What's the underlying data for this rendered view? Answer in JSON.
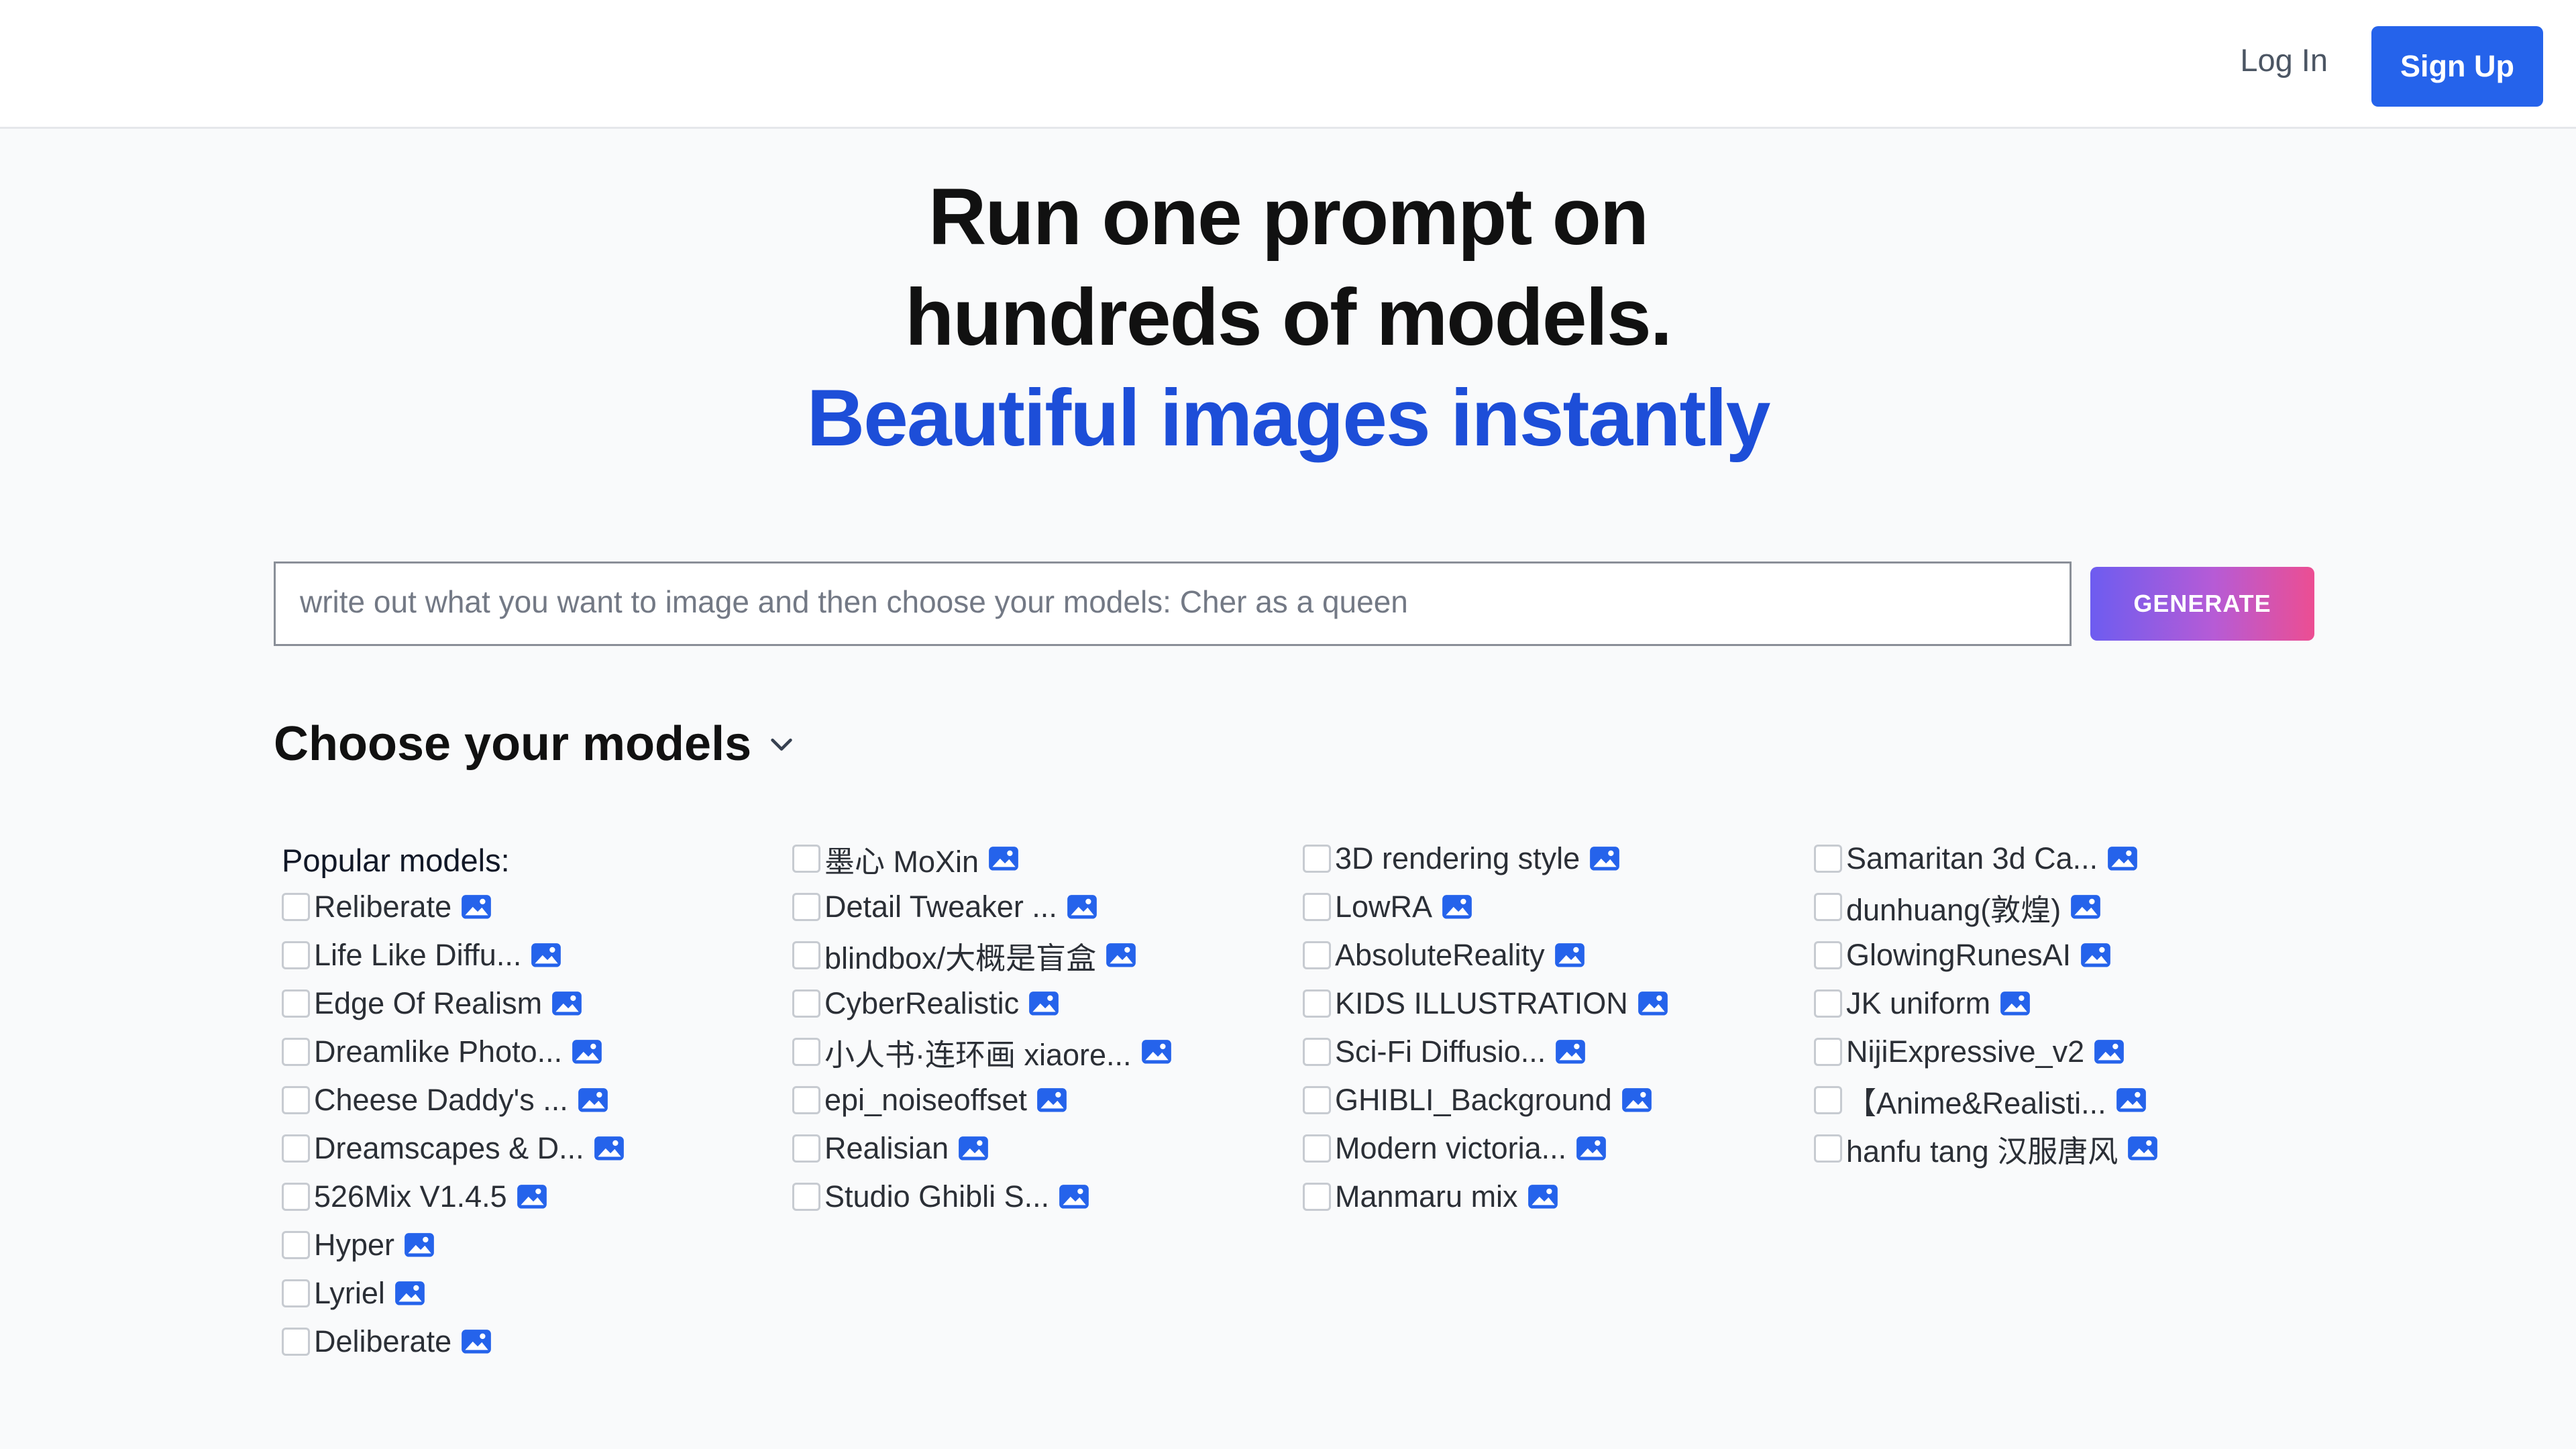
{
  "header": {
    "login_label": "Log In",
    "signup_label": "Sign Up"
  },
  "hero": {
    "line1": "Run one prompt on",
    "line2": "hundreds of models.",
    "line3": "Beautiful images instantly"
  },
  "prompt": {
    "placeholder": "write out what you want to image and then choose your models: Cher as a queen",
    "value": ""
  },
  "generate_label": "GENERATE",
  "models_heading": "Choose your models",
  "popular_label": "Popular models:",
  "columns": [
    [
      "Reliberate",
      "Life Like Diffu...",
      "Edge Of Realism",
      "Dreamlike Photo...",
      "Cheese Daddy's ...",
      "Dreamscapes & D...",
      "526Mix V1.4.5",
      "Hyper",
      "Lyriel",
      "Deliberate"
    ],
    [
      "墨心 MoXin",
      "Detail Tweaker ...",
      "blindbox/大概是盲盒",
      "CyberRealistic",
      "小人书·连环画 xiaore...",
      "epi_noiseoffset",
      "Realisian",
      "Studio Ghibli S..."
    ],
    [
      "3D rendering style",
      "LowRA",
      "AbsoluteReality",
      "KIDS ILLUSTRATION",
      "Sci-Fi Diffusio...",
      "GHIBLI_Background",
      "Modern victoria...",
      "Manmaru mix"
    ],
    [
      "Samaritan 3d Ca...",
      "dunhuang(敦煌)",
      "GlowingRunesAI",
      "JK uniform",
      "NijiExpressive_v2",
      "【Anime&Realisti...",
      "hanfu tang 汉服唐风"
    ]
  ],
  "icons": {
    "model_image": "image-gallery-icon",
    "chevron": "chevron-down-icon"
  },
  "colors": {
    "accent": "#2563eb",
    "hero_blue": "#1d4ed8"
  }
}
